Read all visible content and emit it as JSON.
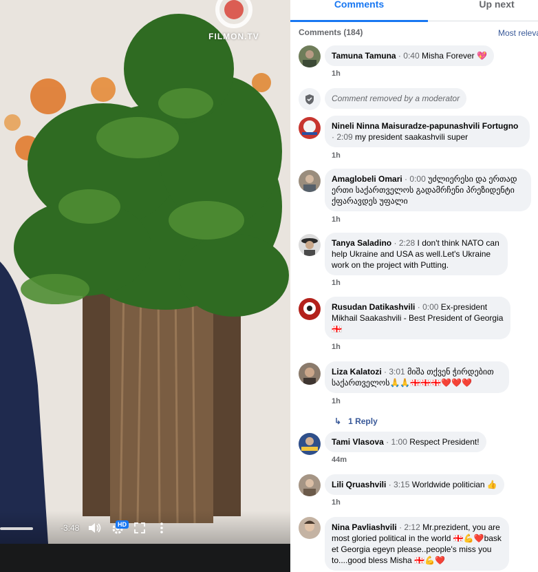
{
  "video": {
    "watermark": "FILMON.TV",
    "time_remaining": "-3:48",
    "hd_badge": "HD",
    "icons": [
      "volume-icon",
      "settings-icon",
      "fullscreen-icon",
      "more-icon"
    ]
  },
  "tabs": {
    "comments": "Comments",
    "up_next": "Up next"
  },
  "comments_header": {
    "count": "Comments (184)",
    "sort": "Most relevant"
  },
  "comments": [
    {
      "name": "Tamuna Tamuna",
      "stamp": "0:40",
      "text": "Misha Forever 💖",
      "age": "1h"
    },
    {
      "removed": "Comment removed by a moderator"
    },
    {
      "name": "Nineli Ninna Maisuradze-papunashvili Fortugno",
      "stamp": "2:09",
      "text": "my president saakashvili super",
      "age": "1h"
    },
    {
      "name": "Amaglobeli Omari",
      "stamp": "0:00",
      "text": "უძლიერესი და ერთად ერთი საქართველოს გადამრჩენი პრეზიდენტი ქფარავდეს უფალი",
      "age": "1h"
    },
    {
      "name": "Tanya Saladino",
      "stamp": "2:28",
      "text": "I don't think NATO can help Ukraine and USA as well.Let's Ukraine work on the project with Putting.",
      "age": "1h"
    },
    {
      "name": "Rusudan Datikashvili",
      "stamp": "0:00",
      "text": "Ex-president Mikhail Saakashvili - Best President of Georgia 🇬🇪",
      "age": "1h"
    },
    {
      "name": "Liza Kalatozi",
      "stamp": "3:01",
      "text": "მიშა თქვენ ჭირდებით საქართველოს🙏🙏🇬🇪🇬🇪🇬🇪❤️❤️❤️",
      "age": "1h",
      "replies": "1 Reply"
    },
    {
      "name": "Tami Vlasova",
      "stamp": "1:00",
      "text": "Respect President!",
      "age": "44m"
    },
    {
      "name": "Lili Qruashvili",
      "stamp": "3:15",
      "text": "Worldwide politician 👍",
      "age": "1h"
    },
    {
      "name": "Nina Pavliashvili",
      "stamp": "2:12",
      "text": "Mr.prezident, you are most gloried political in the world 🇬🇪💪❤️bask et Georgia egeyn please..people's miss you to....good bless Misha 🇬🇪💪❤️",
      "age": ""
    }
  ],
  "colors": {
    "accent": "#1877f2",
    "bubble": "#f0f2f5",
    "muted": "#65676b",
    "link": "#385898"
  }
}
